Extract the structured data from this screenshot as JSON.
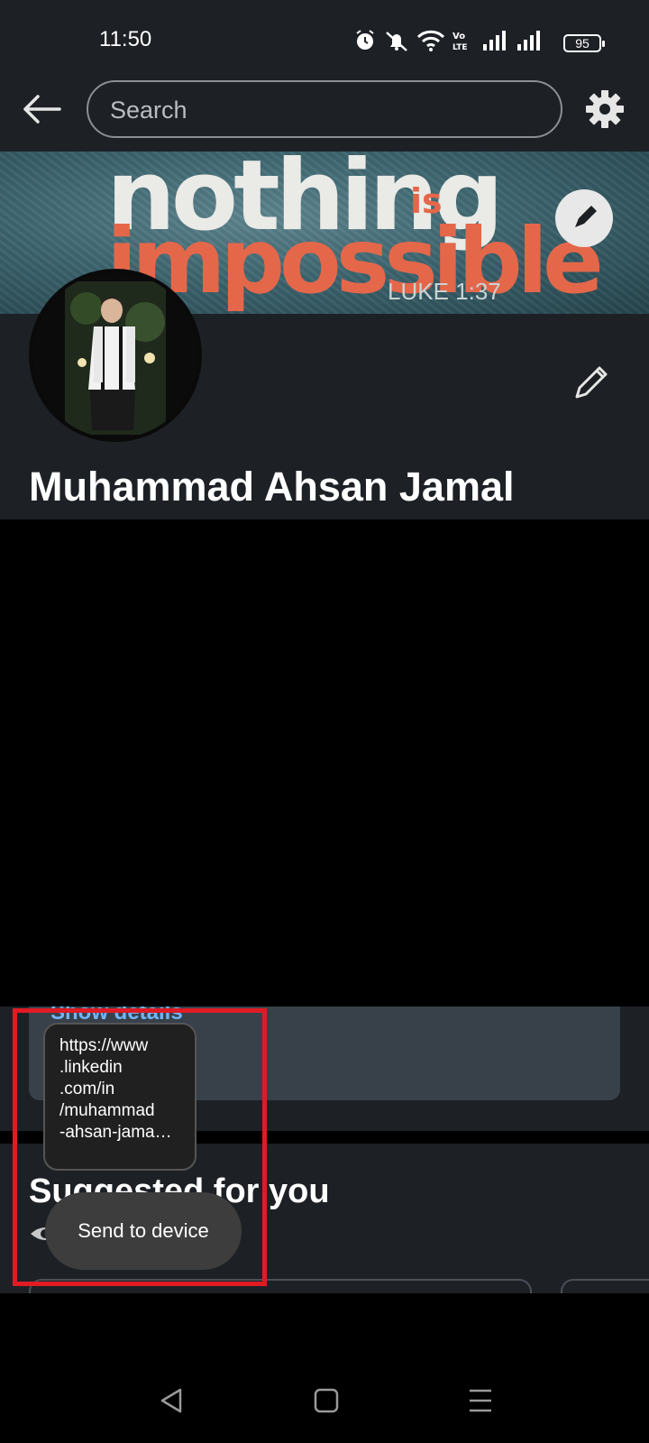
{
  "status_bar": {
    "time": "11:50",
    "battery": "95",
    "icons": [
      "alarm-icon",
      "mute-icon",
      "wifi-icon",
      "volte-icon",
      "signal-icon",
      "signal-icon"
    ]
  },
  "app_bar": {
    "back_icon": "arrow-left-icon",
    "search_placeholder": "Search",
    "settings_icon": "gear-icon"
  },
  "banner": {
    "line1": "nothing",
    "line1_small": "is",
    "line2": "impossible",
    "verse": "LUKE 1:37",
    "edit_icon": "pencil-icon"
  },
  "profile": {
    "name": "Muhammad Ahsan Jamal",
    "edit_icon": "pencil-icon"
  },
  "card": {
    "show_details": "Show details"
  },
  "suggested": {
    "title": "Suggested for you",
    "private_icon": "eye-icon"
  },
  "share_popup": {
    "url_lines": [
      "https://www",
      ".linkedin",
      ".com/in",
      "/muhammad",
      "-ahsan-jama…"
    ],
    "send_button": "Send to device"
  },
  "navbar": {
    "back": "nav-back-icon",
    "home": "nav-home-icon",
    "recents": "nav-menu-icon"
  },
  "colors": {
    "background": "#1d2126",
    "link": "#70b5f9",
    "highlight": "#e01b24",
    "banner_accent": "#e4674a"
  }
}
